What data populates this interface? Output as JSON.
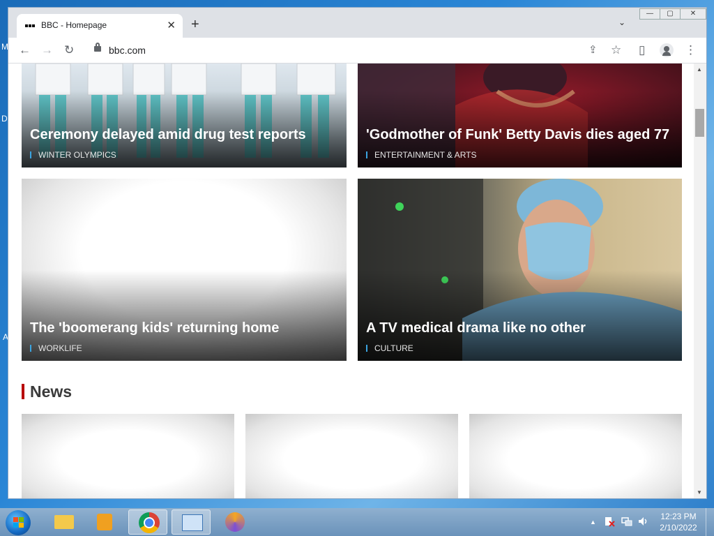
{
  "browser": {
    "tab_title": "BBC - Homepage",
    "tab_close": "✕",
    "new_tab": "+",
    "tab_search": "⌄",
    "url": "bbc.com",
    "window_controls": {
      "minimize": "—",
      "maximize": "▢",
      "close": "✕"
    }
  },
  "toolbar_icons": {
    "back": "←",
    "forward": "→",
    "reload": "↻",
    "share": "⇪",
    "bookmark": "☆",
    "side_panel": "▯",
    "menu": "⋮"
  },
  "stories": [
    {
      "headline": "Ceremony delayed amid drug test reports",
      "tag": "WINTER OLYMPICS"
    },
    {
      "headline": "'Godmother of Funk' Betty Davis dies aged 77",
      "tag": "ENTERTAINMENT & ARTS"
    },
    {
      "headline": "The 'boomerang kids' returning home",
      "tag": "WORKLIFE"
    },
    {
      "headline": "A TV medical drama like no other",
      "tag": "CULTURE"
    }
  ],
  "section": {
    "news_title": "News"
  },
  "scrollbar": {
    "up": "▲",
    "down": "▼"
  },
  "desktop_fragments": {
    "m": "M",
    "d": "D",
    "a": "A"
  },
  "taskbar": {
    "tray_arrow": "▲",
    "clock_time": "12:23 PM",
    "clock_date": "2/10/2022"
  }
}
